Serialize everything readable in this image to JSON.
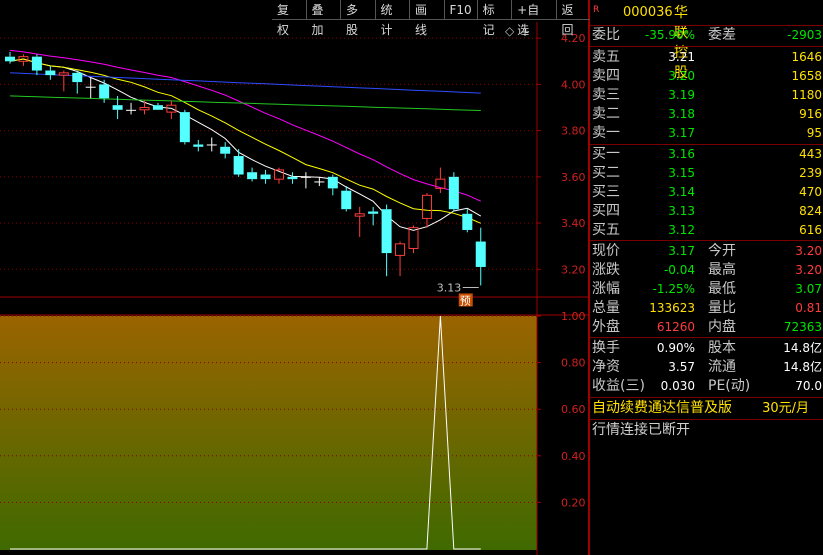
{
  "toolbar": {
    "items": [
      "复权",
      "叠加",
      "多股",
      "统计",
      "画线",
      "F10",
      "标记",
      "+自选",
      "返回"
    ]
  },
  "stock": {
    "flag": "R",
    "code": "000036",
    "name": "华联控股"
  },
  "ratio": {
    "label1": "委比",
    "value1": "-35.90%",
    "label2": "委差",
    "value2": "-2903"
  },
  "asks": [
    {
      "label": "卖五",
      "price": "3.21",
      "vol": "1646"
    },
    {
      "label": "卖四",
      "price": "3.20",
      "vol": "1658"
    },
    {
      "label": "卖三",
      "price": "3.19",
      "vol": "1180"
    },
    {
      "label": "卖二",
      "price": "3.18",
      "vol": "916"
    },
    {
      "label": "卖一",
      "price": "3.17",
      "vol": "95"
    }
  ],
  "bids": [
    {
      "label": "买一",
      "price": "3.16",
      "vol": "443"
    },
    {
      "label": "买二",
      "price": "3.15",
      "vol": "239"
    },
    {
      "label": "买三",
      "price": "3.14",
      "vol": "470"
    },
    {
      "label": "买四",
      "price": "3.13",
      "vol": "824"
    },
    {
      "label": "买五",
      "price": "3.12",
      "vol": "616"
    }
  ],
  "quote": [
    {
      "l1": "现价",
      "v1": "3.17",
      "l2": "今开",
      "v2": "3.20"
    },
    {
      "l1": "涨跌",
      "v1": "-0.04",
      "l2": "最高",
      "v2": "3.20"
    },
    {
      "l1": "涨幅",
      "v1": "-1.25%",
      "l2": "最低",
      "v2": "3.07"
    },
    {
      "l1": "总量",
      "v1": "133623",
      "l2": "量比",
      "v2": "0.81"
    },
    {
      "l1": "外盘",
      "v1": "61260",
      "l2": "内盘",
      "v2": "72363"
    }
  ],
  "fund": [
    {
      "l1": "换手",
      "v1": "0.90%",
      "l2": "股本",
      "v2": "14.8亿"
    },
    {
      "l1": "净资",
      "v1": "3.57",
      "l2": "流通",
      "v2": "14.8亿"
    },
    {
      "l1": "收益(三)",
      "v1": "0.030",
      "l2": "PE(动)",
      "v2": "70.0"
    }
  ],
  "promo": {
    "text": "自动续费通达信普及版",
    "price": "30元/月"
  },
  "status": "行情连接已断开",
  "chart_data": [
    {
      "type": "candlestick",
      "ylim": [
        3.08,
        4.27
      ],
      "yticks": [
        "4.20",
        "4.00",
        "3.80",
        "3.60",
        "3.40",
        "3.20"
      ],
      "low_label": "3.13",
      "badge": "预",
      "candles": [
        {
          "o": 4.12,
          "h": 4.14,
          "l": 4.09,
          "c": 4.1
        },
        {
          "o": 4.1,
          "h": 4.13,
          "l": 4.08,
          "c": 4.12
        },
        {
          "o": 4.12,
          "h": 4.13,
          "l": 4.04,
          "c": 4.06
        },
        {
          "o": 4.06,
          "h": 4.08,
          "l": 4.02,
          "c": 4.04
        },
        {
          "o": 4.04,
          "h": 4.06,
          "l": 3.97,
          "c": 4.05
        },
        {
          "o": 4.05,
          "h": 4.06,
          "l": 3.96,
          "c": 4.01
        },
        {
          "o": 3.99,
          "h": 4.03,
          "l": 3.94,
          "c": 3.99
        },
        {
          "o": 4.0,
          "h": 4.02,
          "l": 3.92,
          "c": 3.94
        },
        {
          "o": 3.91,
          "h": 3.95,
          "l": 3.85,
          "c": 3.89
        },
        {
          "o": 3.89,
          "h": 3.92,
          "l": 3.87,
          "c": 3.89
        },
        {
          "o": 3.89,
          "h": 3.93,
          "l": 3.87,
          "c": 3.9
        },
        {
          "o": 3.91,
          "h": 3.92,
          "l": 3.89,
          "c": 3.89
        },
        {
          "o": 3.88,
          "h": 3.93,
          "l": 3.85,
          "c": 3.91
        },
        {
          "o": 3.88,
          "h": 3.89,
          "l": 3.74,
          "c": 3.75
        },
        {
          "o": 3.74,
          "h": 3.76,
          "l": 3.71,
          "c": 3.73
        },
        {
          "o": 3.74,
          "h": 3.77,
          "l": 3.71,
          "c": 3.74
        },
        {
          "o": 3.73,
          "h": 3.75,
          "l": 3.68,
          "c": 3.7
        },
        {
          "o": 3.69,
          "h": 3.72,
          "l": 3.6,
          "c": 3.61
        },
        {
          "o": 3.62,
          "h": 3.64,
          "l": 3.58,
          "c": 3.59
        },
        {
          "o": 3.61,
          "h": 3.63,
          "l": 3.57,
          "c": 3.59
        },
        {
          "o": 3.59,
          "h": 3.64,
          "l": 3.57,
          "c": 3.63
        },
        {
          "o": 3.6,
          "h": 3.62,
          "l": 3.57,
          "c": 3.59
        },
        {
          "o": 3.6,
          "h": 3.62,
          "l": 3.55,
          "c": 3.6
        },
        {
          "o": 3.58,
          "h": 3.6,
          "l": 3.56,
          "c": 3.58
        },
        {
          "o": 3.6,
          "h": 3.61,
          "l": 3.52,
          "c": 3.55
        },
        {
          "o": 3.54,
          "h": 3.56,
          "l": 3.45,
          "c": 3.46
        },
        {
          "o": 3.43,
          "h": 3.47,
          "l": 3.34,
          "c": 3.44
        },
        {
          "o": 3.45,
          "h": 3.47,
          "l": 3.39,
          "c": 3.44
        },
        {
          "o": 3.46,
          "h": 3.48,
          "l": 3.17,
          "c": 3.27
        },
        {
          "o": 3.26,
          "h": 3.32,
          "l": 3.17,
          "c": 3.31
        },
        {
          "o": 3.29,
          "h": 3.39,
          "l": 3.27,
          "c": 3.38
        },
        {
          "o": 3.42,
          "h": 3.53,
          "l": 3.38,
          "c": 3.52
        },
        {
          "o": 3.55,
          "h": 3.64,
          "l": 3.53,
          "c": 3.59
        },
        {
          "o": 3.6,
          "h": 3.62,
          "l": 3.45,
          "c": 3.46
        },
        {
          "o": 3.44,
          "h": 3.46,
          "l": 3.36,
          "c": 3.37
        },
        {
          "o": 3.32,
          "h": 3.38,
          "l": 3.13,
          "c": 3.21
        }
      ]
    },
    {
      "type": "line",
      "ylim": [
        0,
        1.0
      ],
      "yticks": [
        "1.00",
        "0.80",
        "0.60",
        "0.40",
        "0.20"
      ],
      "values": [
        0,
        0,
        0,
        0,
        0,
        0,
        0,
        0,
        0,
        0,
        0,
        0,
        0,
        0,
        0,
        0,
        0,
        0,
        0,
        0,
        0,
        0,
        0,
        0,
        0,
        0,
        0,
        0,
        0,
        0,
        0,
        0,
        1,
        0,
        0,
        0
      ]
    }
  ]
}
